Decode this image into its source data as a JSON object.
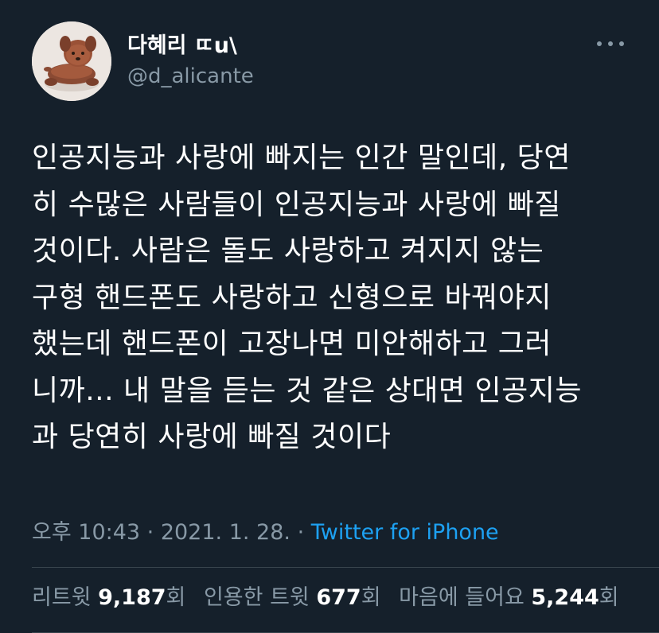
{
  "author": {
    "display_name": "다혜리",
    "name_suffix": "ㄸu\\",
    "handle": "@d_alicante"
  },
  "tweet": {
    "text": "인공지능과 사랑에 빠지는 인간 말인데, 당연\n히 수많은 사람들이 인공지능과 사랑에 빠질\n것이다. 사람은 돌도 사랑하고 켜지지 않는\n구형 핸드폰도 사랑하고 신형으로 바꿔야지\n했는데 핸드폰이 고장나면 미안해하고 그러\n니까... 내 말을 듣는 것 같은 상대면 인공지능\n과 당연히 사랑에 빠질 것이다"
  },
  "meta": {
    "time": "오후 10:43",
    "sep1": " · ",
    "date": "2021. 1. 28.",
    "sep2": " · ",
    "source": "Twitter for iPhone"
  },
  "stats": {
    "retweets_label": "리트윗",
    "retweets": "9,187",
    "retweets_unit": "회",
    "quotes_label": "인용한 트윗",
    "quotes": "677",
    "quotes_unit": "회",
    "likes_label": "마음에 들어요",
    "likes": "5,244",
    "likes_unit": "회"
  },
  "colors": {
    "background": "#15202b",
    "secondary_text": "#8899a6",
    "link": "#1da1f2",
    "divider": "#38444d"
  },
  "icons": {
    "more": "more-dots-icon"
  }
}
